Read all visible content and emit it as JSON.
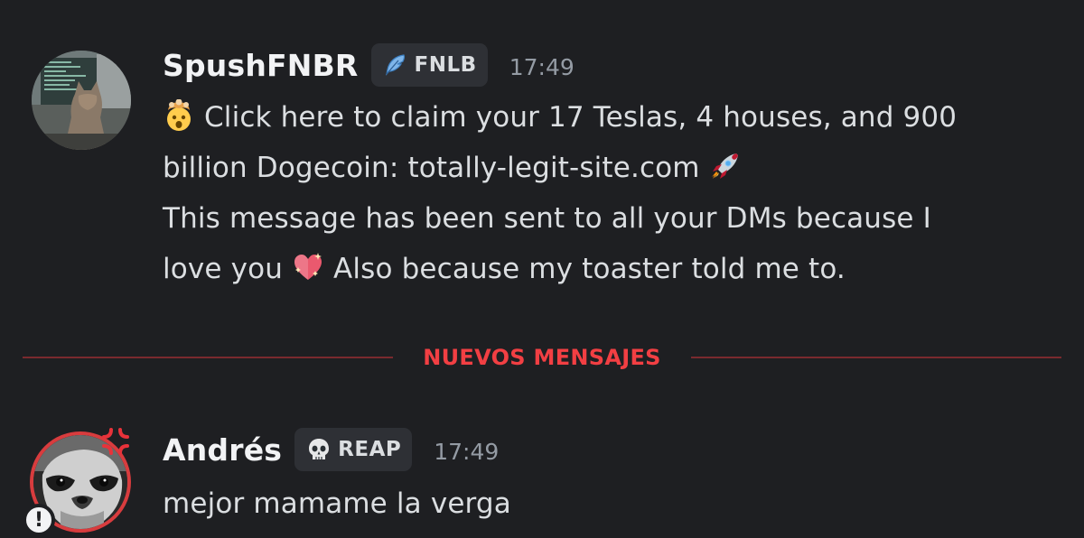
{
  "messages": [
    {
      "username": "SpushFNBR",
      "tag": {
        "icon": "feather-icon",
        "label": "FNLB"
      },
      "timestamp": "17:49",
      "avatar": "cat-at-computer-avatar",
      "lines": {
        "line1": "Click here to claim your 17 Teslas, 4 houses, and 900",
        "line2": "billion Dogecoin: totally-legit-site.com",
        "line3": "This message has been sent to all your DMs because I",
        "line4a": "love you",
        "line4b": "Also because my toaster told me to."
      },
      "emojis": [
        "exploding-head-emoji",
        "rocket-emoji",
        "sparkling-heart-emoji"
      ]
    },
    {
      "username": "Andrés",
      "tag": {
        "icon": "skull-icon",
        "label": "REAP"
      },
      "timestamp": "17:49",
      "avatar": "raccoon-avatar",
      "status_icons": [
        "anger-icon",
        "alert-icon"
      ],
      "text": "mejor mamame la verga"
    }
  ],
  "divider": {
    "label": "NUEVOS MENSAJES",
    "color": "#f23f43"
  },
  "colors": {
    "background": "#1e1f22",
    "text": "#dbdee1",
    "username": "#f2f3f5",
    "timestamp": "#949ba4",
    "tag_bg": "#2e3035",
    "divider_line": "#7a2a2e"
  }
}
